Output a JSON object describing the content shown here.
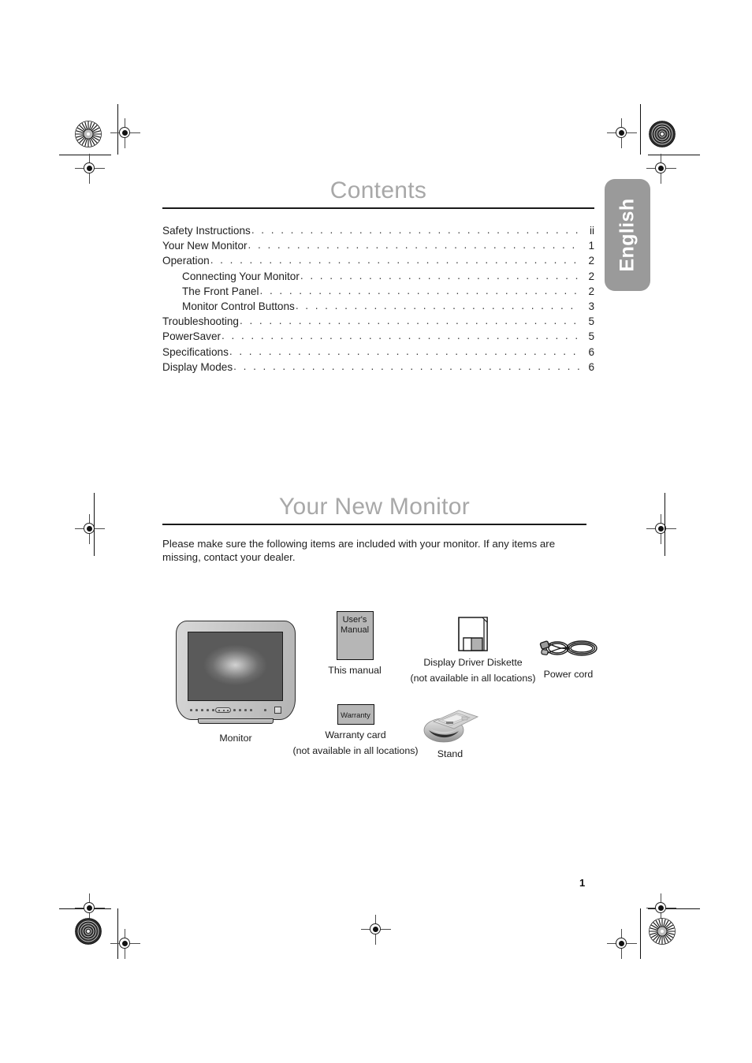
{
  "document": {
    "page_number": "1",
    "language_tab": "English"
  },
  "contents": {
    "heading": "Contents",
    "entries": [
      {
        "label": "Safety Instructions",
        "page": "ii",
        "level": 0
      },
      {
        "label": "Your New Monitor",
        "page": "1",
        "level": 0
      },
      {
        "label": "Operation",
        "page": "2",
        "level": 0
      },
      {
        "label": "Connecting Your Monitor",
        "page": "2",
        "level": 1
      },
      {
        "label": "The Front Panel",
        "page": "2",
        "level": 1
      },
      {
        "label": "Monitor Control Buttons",
        "page": "3",
        "level": 1
      },
      {
        "label": "Troubleshooting",
        "page": "5",
        "level": 0
      },
      {
        "label": "PowerSaver",
        "page": "5",
        "level": 0
      },
      {
        "label": "Specifications",
        "page": "6",
        "level": 0
      },
      {
        "label": "Display Modes",
        "page": "6",
        "level": 0
      }
    ]
  },
  "your_new_monitor": {
    "heading": "Your New Monitor",
    "intro": "Please make sure the following items are included with your monitor. If any items are missing, contact your dealer.",
    "items": {
      "monitor": {
        "caption": "Monitor"
      },
      "manual": {
        "face_text": "User's\nManual",
        "caption": "This manual"
      },
      "warranty": {
        "face_text": "Warranty",
        "caption": "Warranty card",
        "caption2": "(not available in all locations)"
      },
      "diskette": {
        "caption": "Display Driver Diskette",
        "caption2": "(not available in all locations)"
      },
      "power_cord": {
        "caption": "Power cord"
      },
      "stand": {
        "caption": "Stand"
      }
    }
  },
  "colors": {
    "heading_gray": "#a8a8a8",
    "tab_gray": "#9a9a9a",
    "rule_black": "#1a1a1a",
    "illustration_gray": "#b6b6b6",
    "text_black": "#1f1f1f"
  }
}
